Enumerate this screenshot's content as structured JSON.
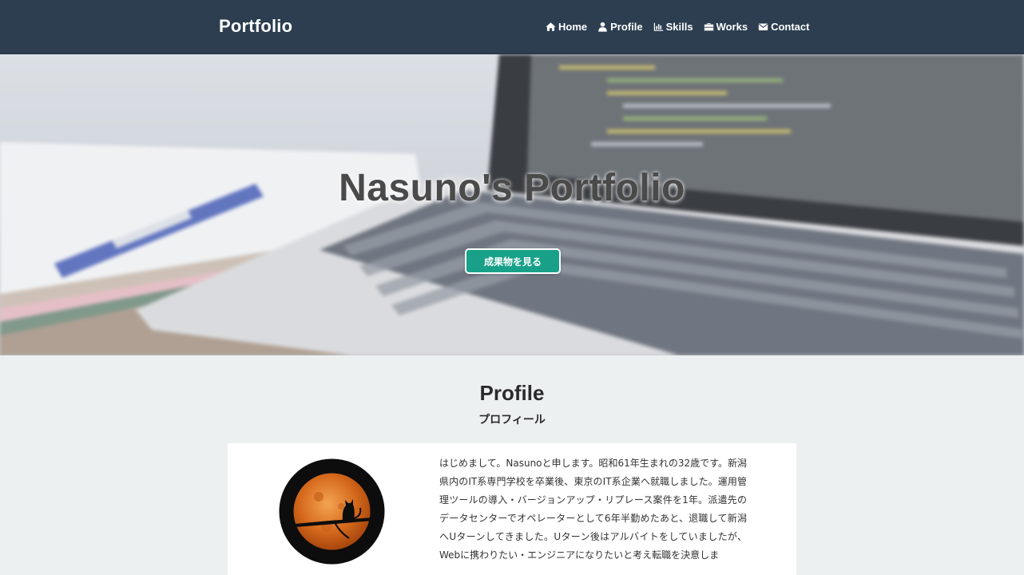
{
  "navbar": {
    "brand": "Portfolio",
    "items": [
      {
        "label": "Home",
        "icon": "home-icon"
      },
      {
        "label": "Profile",
        "icon": "user-icon"
      },
      {
        "label": "Skills",
        "icon": "chart-icon"
      },
      {
        "label": "Works",
        "icon": "briefcase-icon"
      },
      {
        "label": "Contact",
        "icon": "envelope-icon"
      }
    ]
  },
  "hero": {
    "title": "Nasuno's Portfolio",
    "button_label": "成果物を見る"
  },
  "profile": {
    "title": "Profile",
    "subtitle": "プロフィール",
    "bio": "はじめまして。Nasunoと申します。昭和61年生まれの32歳です。新潟県内のIT系専門学校を卒業後、東京のIT系企業へ就職しました。運用管理ツールの導入・バージョンアップ・リプレース案件を1年。派遣先のデータセンターでオペレーターとして6年半勤めたあと、退職して新潟へUターンしてきました。Uターン後はアルバイトをしていましたが、Webに携わりたい・エンジニアになりたいと考え転職を決意しま"
  },
  "colors": {
    "navbar": "#2c3e50",
    "accent": "#18a188",
    "section_bg": "#ecf0f1"
  }
}
